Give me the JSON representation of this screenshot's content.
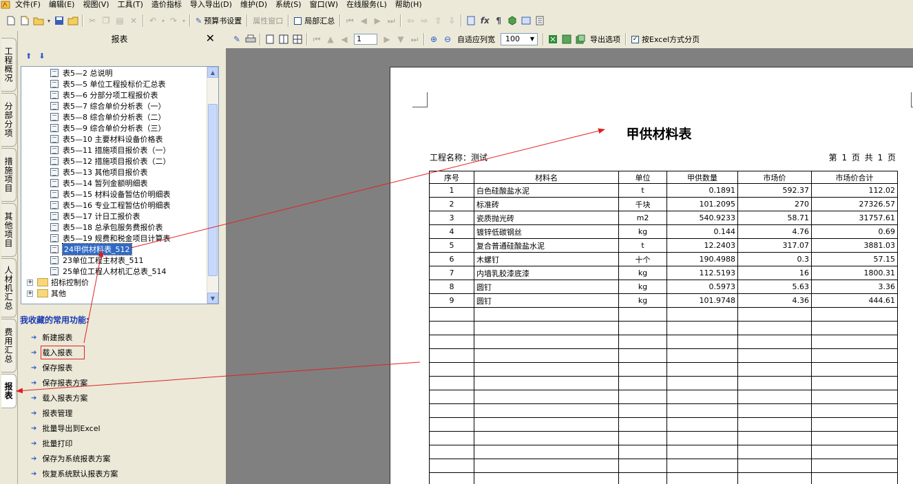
{
  "menubar": {
    "items": [
      "文件(F)",
      "编辑(E)",
      "视图(V)",
      "工具(T)",
      "造价指标",
      "导入导出(D)",
      "维护(D)",
      "系统(S)",
      "窗口(W)",
      "在线服务(L)",
      "帮助(H)"
    ]
  },
  "toolbar1": {
    "budget_settings_label": "预算书设置",
    "property_window_label": "属性窗口",
    "partial_summary_label": "局部汇总"
  },
  "vtabs": [
    "工程概况",
    "分部分项",
    "措施项目",
    "其他项目",
    "人材机汇总",
    "费用汇总",
    "报表"
  ],
  "panel": {
    "title": "报表",
    "tree": [
      "表5—2 总说明",
      "表5—5 单位工程投标价汇总表",
      "表5—6 分部分项工程报价表",
      "表5—7 综合单价分析表（一）",
      "表5—8 综合单价分析表（二）",
      "表5—9 综合单价分析表（三）",
      "表5—10 主要材料设备价格表",
      "表5—11 措施项目报价表（一）",
      "表5—12 措施项目报价表（二）",
      "表5—13 其他项目报价表",
      "表5—14 暂列金额明细表",
      "表5—15 材料设备暂估价明细表",
      "表5—16 专业工程暂估价明细表",
      "表5—17 计日工报价表",
      "表5—18 总承包服务费报价表",
      "表5—19 规费和税金项目计算表",
      "24甲供材料表_512",
      "23单位工程主材表_511",
      "25单位工程人材机汇总表_514"
    ],
    "folders": [
      "招标控制价",
      "其他"
    ],
    "favorites_title": "我收藏的常用功能:",
    "favorites": [
      "新建报表",
      "载入报表",
      "保存报表",
      "保存报表方案",
      "载入报表方案",
      "报表管理",
      "批量导出到Excel",
      "批量打印",
      "保存为系统报表方案",
      "恢复系统默认报表方案"
    ]
  },
  "toolbar2": {
    "page_value": "1",
    "fit_width_label": "自适应列宽",
    "zoom_value": "100",
    "export_options_label": "导出选项",
    "excel_paging_label": "按Excel方式分页"
  },
  "report": {
    "title": "甲供材料表",
    "project_label": "工程名称：测试",
    "page_info": "第 1 页  共 1 页",
    "headers": [
      "序号",
      "材料名",
      "单位",
      "甲供数量",
      "市场价",
      "市场价合计"
    ],
    "rows": [
      [
        "1",
        "白色硅酸盐水泥",
        "t",
        "0.1891",
        "592.37",
        "112.02"
      ],
      [
        "2",
        "标准砖",
        "千块",
        "101.2095",
        "270",
        "27326.57"
      ],
      [
        "3",
        "瓷质抛光砖",
        "m2",
        "540.9233",
        "58.71",
        "31757.61"
      ],
      [
        "4",
        "镀锌低碳钢丝",
        "kg",
        "0.144",
        "4.76",
        "0.69"
      ],
      [
        "5",
        "复合普通硅酸盐水泥",
        "t",
        "12.2403",
        "317.07",
        "3881.03"
      ],
      [
        "6",
        "木螺钉",
        "十个",
        "190.4988",
        "0.3",
        "57.15"
      ],
      [
        "7",
        "内墙乳胶漆底漆",
        "kg",
        "112.5193",
        "16",
        "1800.31"
      ],
      [
        "8",
        "圆钉",
        "kg",
        "0.5973",
        "5.63",
        "3.36"
      ],
      [
        "9",
        "圆钉",
        "kg",
        "101.9748",
        "4.36",
        "444.61"
      ]
    ]
  },
  "colors": {
    "annotation_red": "#e02020",
    "selection_blue": "#316ac5",
    "viewer_gray": "#808080"
  }
}
